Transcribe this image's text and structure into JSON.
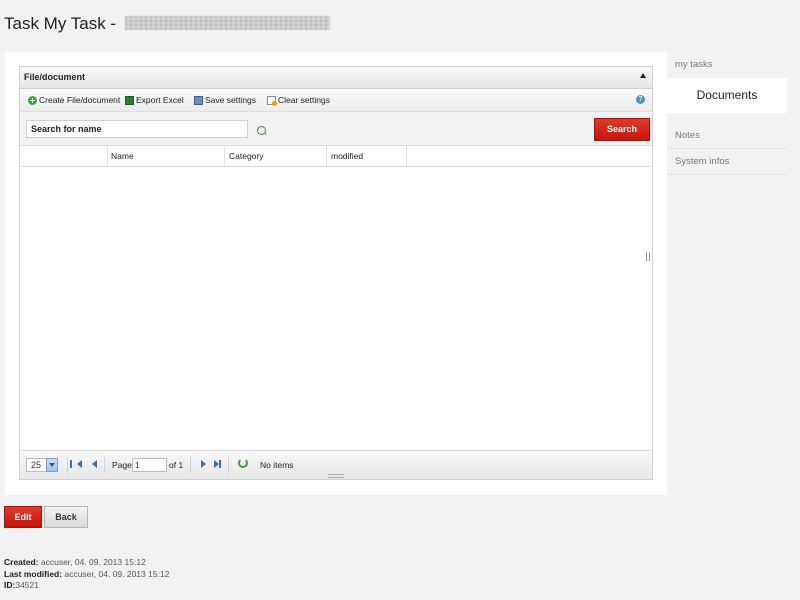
{
  "title": {
    "prefix": "Task My Task -"
  },
  "grid": {
    "title": "File/document",
    "toolbar": {
      "create": "Create File/document",
      "export": "Export Excel",
      "save": "Save settings",
      "clear": "Clear settings",
      "help_icon": "question-icon"
    },
    "search": {
      "placeholder": "Search for name",
      "button": "Search"
    },
    "columns": [
      "",
      "Name",
      "Category",
      "modified",
      ""
    ],
    "pager": {
      "page_size": "25",
      "page_label": "Page",
      "page_value": "1",
      "of_label": "of 1",
      "status": "No items"
    }
  },
  "side_nav": {
    "items": [
      "my tasks",
      "Documents",
      "Notes",
      "System infos"
    ],
    "active": "Documents"
  },
  "actions": {
    "edit": "Edit",
    "back": "Back"
  },
  "meta": {
    "created_label": "Created:",
    "created_value": "accuser, 04. 09. 2013 15:12",
    "modified_label": "Last modified:",
    "modified_value": "accuser, 04. 09. 2013 15:12",
    "id_label": "ID:",
    "id_value": "34521"
  },
  "colors": {
    "accent_red": "#d42419",
    "background": "#f2f2f2",
    "panel": "#ffffff"
  }
}
